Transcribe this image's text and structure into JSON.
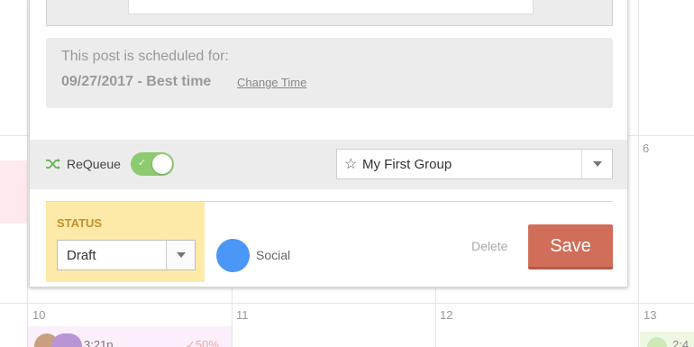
{
  "calendar": {
    "day_numbers": {
      "d6": "6",
      "d10": "10",
      "d11": "11",
      "d12": "12",
      "d13": "13"
    },
    "events": {
      "bottom_time": "3:21p",
      "bottom_pct": "✓50%",
      "right_time": "2:4"
    }
  },
  "modal": {
    "schedule": {
      "label": "This post is scheduled for:",
      "when": "09/27/2017 - Best time",
      "change_link": "Change Time"
    },
    "requeue": {
      "label": "ReQueue",
      "enabled": true,
      "group_value": "My First Group"
    },
    "status": {
      "title": "STATUS",
      "value": "Draft"
    },
    "social": {
      "label": "Social",
      "color": "#4a97f7"
    },
    "actions": {
      "delete_label": "Delete",
      "save_label": "Save",
      "save_color": "#d06e59"
    }
  }
}
